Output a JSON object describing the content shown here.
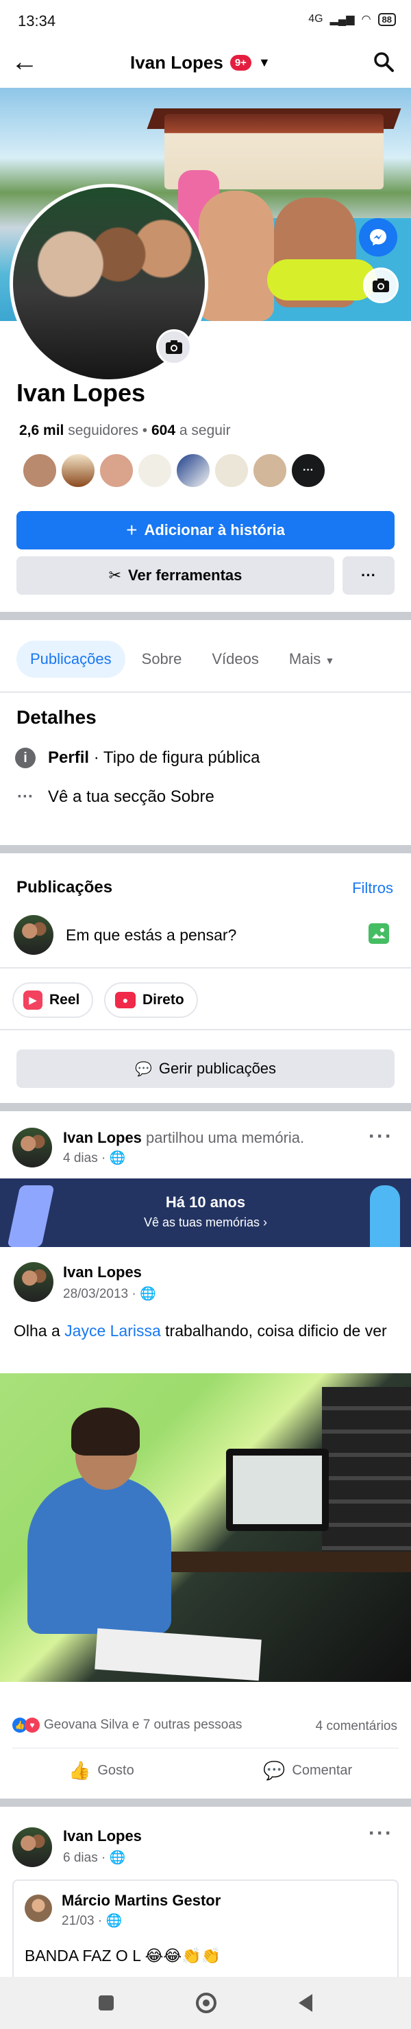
{
  "status_bar": {
    "time": "13:34",
    "network": "4G",
    "battery": "88"
  },
  "header": {
    "profile_name": "Ivan Lopes",
    "notification_badge": "9+"
  },
  "profile": {
    "name": "Ivan Lopes",
    "followers_count": "2,6 mil",
    "followers_label": "seguidores",
    "following_count": "604",
    "following_label": "a seguir",
    "add_story_label": "Adicionar à história",
    "tools_label": "Ver ferramentas",
    "more_label": "···"
  },
  "tabs": [
    {
      "label": "Publicações"
    },
    {
      "label": "Sobre"
    },
    {
      "label": "Vídeos"
    },
    {
      "label": "Mais"
    }
  ],
  "details": {
    "title": "Detalhes",
    "profile_strong": "Perfil",
    "profile_rest": " · Tipo de figura pública",
    "about_link": "Vê a tua secção Sobre"
  },
  "posts_section": {
    "title": "Publicações",
    "filters_label": "Filtros",
    "composer_placeholder": "Em que estás a pensar?",
    "reel_label": "Reel",
    "live_label": "Direto",
    "manage_label": "Gerir publicações"
  },
  "post1": {
    "author": "Ivan Lopes",
    "action": "partilhou uma memória.",
    "time": "4 dias",
    "memory_title": "Há 10 anos",
    "memory_sub": "Vê as tuas memórias",
    "inner_author": "Ivan Lopes",
    "inner_date": "28/03/2013",
    "text_before": "Olha a ",
    "mention": "Jayce Larissa",
    "text_after": " trabalhando, coisa dificio de ver",
    "reactions_text": "Geovana Silva e 7 outras pessoas",
    "comments_count": "4 comentários",
    "like_label": "Gosto",
    "comment_label": "Comentar"
  },
  "post2": {
    "author": "Ivan Lopes",
    "time": "6 dias",
    "inner_author": "Márcio Martins Gestor",
    "inner_date": "21/03",
    "text": "BANDA FAZ O L 😂😂👏👏"
  },
  "colors": {
    "brand": "#1877f2",
    "separator": "#c9ccd1",
    "gray_button": "#e4e6eb"
  }
}
